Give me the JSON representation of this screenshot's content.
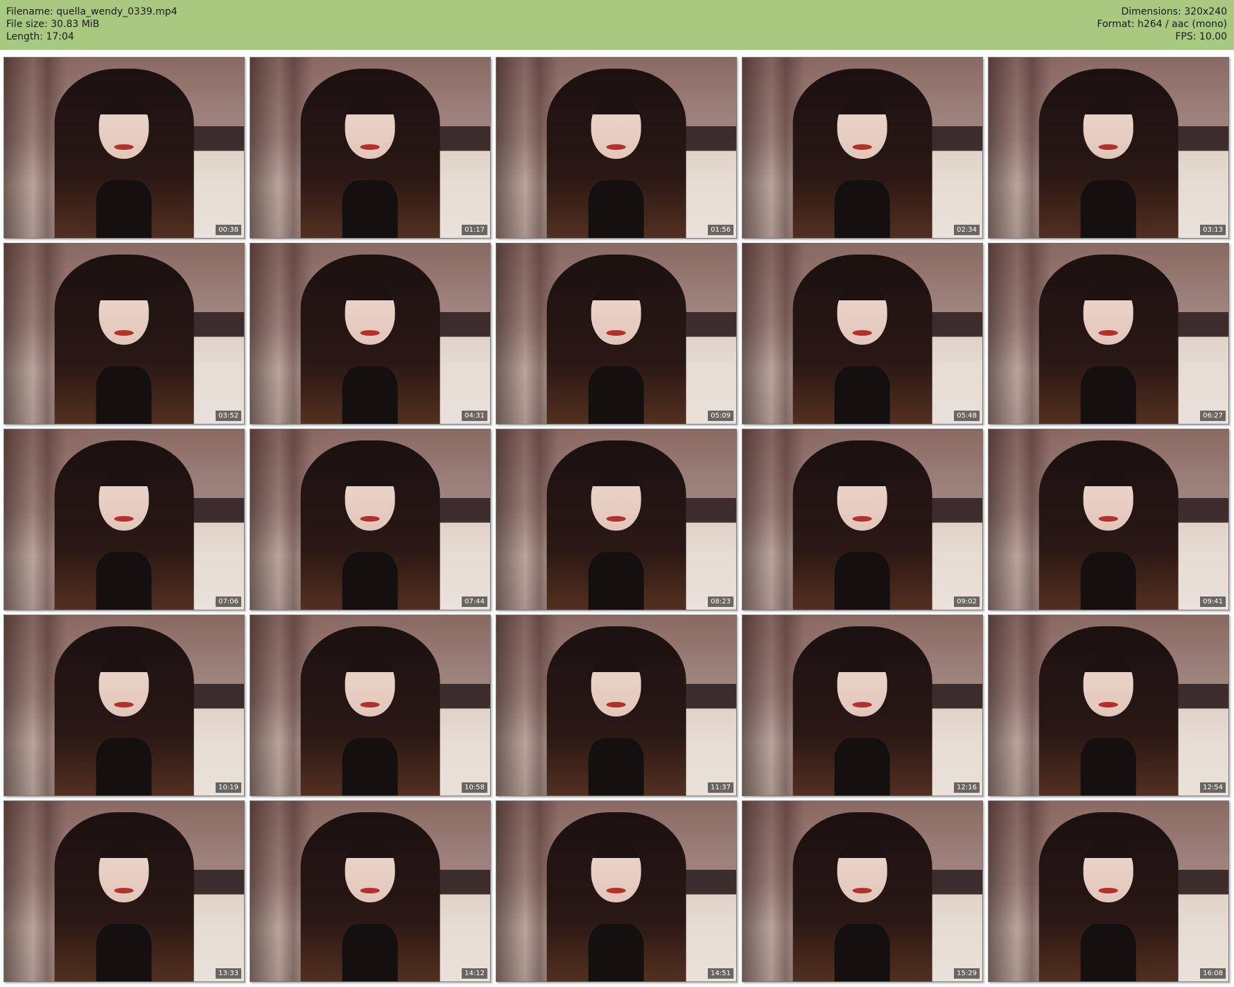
{
  "header": {
    "left": [
      "Filename: quella_wendy_0339.mp4",
      "File size: 30.83 MiB",
      "Length: 17:04"
    ],
    "right": [
      "Dimensions: 320x240",
      "Format: h264 / aac (mono)",
      "FPS: 10.00"
    ]
  },
  "thumbnails": [
    {
      "timestamp": "00:38"
    },
    {
      "timestamp": "01:17"
    },
    {
      "timestamp": "01:56"
    },
    {
      "timestamp": "02:34"
    },
    {
      "timestamp": "03:13"
    },
    {
      "timestamp": "03:52"
    },
    {
      "timestamp": "04:31"
    },
    {
      "timestamp": "05:09"
    },
    {
      "timestamp": "05:48"
    },
    {
      "timestamp": "06:27"
    },
    {
      "timestamp": "07:06"
    },
    {
      "timestamp": "07:44"
    },
    {
      "timestamp": "08:23"
    },
    {
      "timestamp": "09:02"
    },
    {
      "timestamp": "09:41"
    },
    {
      "timestamp": "10:19"
    },
    {
      "timestamp": "10:58"
    },
    {
      "timestamp": "11:37"
    },
    {
      "timestamp": "12:16"
    },
    {
      "timestamp": "12:54"
    },
    {
      "timestamp": "13:33"
    },
    {
      "timestamp": "14:12"
    },
    {
      "timestamp": "14:51"
    },
    {
      "timestamp": "15:29"
    },
    {
      "timestamp": "16:08"
    }
  ],
  "colors": {
    "header_bg": "#a8c97f",
    "page_bg": "#ffffff",
    "timestamp_bg": "#000000",
    "timestamp_text": "#ffffff"
  }
}
